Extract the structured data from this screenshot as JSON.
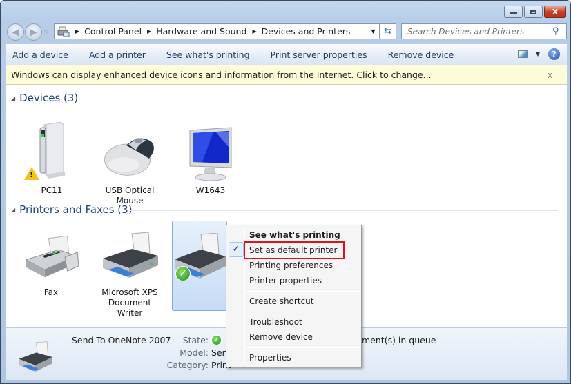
{
  "window": {
    "caption_buttons": {
      "minimize": "minimize",
      "maximize": "maximize",
      "close": "X"
    }
  },
  "nav": {
    "back_icon": "◀",
    "forward_icon": "▶",
    "recent_icon": "▽"
  },
  "address": {
    "crumbs": [
      "Control Panel",
      "Hardware and Sound",
      "Devices and Printers"
    ],
    "separator": "▶",
    "dropdown_icon": "▼",
    "refresh_icon": "⇆"
  },
  "search": {
    "placeholder": "Search Devices and Printers",
    "icon": "⚲"
  },
  "toolbar": {
    "items": [
      "Add a device",
      "Add a printer",
      "See what's printing",
      "Print server properties",
      "Remove device"
    ],
    "view_dropdown_icon": "▼",
    "help_icon": "?"
  },
  "infobar": {
    "message": "Windows can display enhanced device icons and information from the Internet. Click to change...",
    "close": "x"
  },
  "groups": {
    "devices": {
      "title": "Devices (3)",
      "items": [
        {
          "name": "PC11",
          "icon": "computer-tower",
          "status": "warning"
        },
        {
          "name": "USB Optical Mouse",
          "icon": "mouse"
        },
        {
          "name": "W1643",
          "icon": "monitor"
        }
      ]
    },
    "printers": {
      "title": "Printers and Faxes (3)",
      "items": [
        {
          "name": "Fax",
          "icon": "fax"
        },
        {
          "name": "Microsoft XPS Document Writer",
          "icon": "printer"
        },
        {
          "name": "Send To OneNote 2007",
          "icon": "printer",
          "default": true,
          "selected": true
        }
      ]
    }
  },
  "details": {
    "name": "Send To OneNote 2007",
    "state_label": "State:",
    "state_value_visible": "ment(s) in queue",
    "model_label": "Model:",
    "model_value_visible": "Send",
    "category_label": "Category:",
    "category_value_visible": "Print"
  },
  "context_menu": {
    "items": [
      {
        "label": "See what's printing",
        "bold": true
      },
      {
        "label": "Set as default printer",
        "checked": true,
        "highlighted": true
      },
      {
        "label": "Printing preferences"
      },
      {
        "label": "Printer properties"
      },
      {
        "label": "Create shortcut"
      },
      {
        "label": "Troubleshoot"
      },
      {
        "label": "Remove device"
      },
      {
        "label": "Properties"
      }
    ],
    "check_glyph": "✓"
  },
  "colors": {
    "highlight_box": "#e0111b",
    "group_header": "#1e3f8a",
    "infobar": "#fdfbd8"
  }
}
